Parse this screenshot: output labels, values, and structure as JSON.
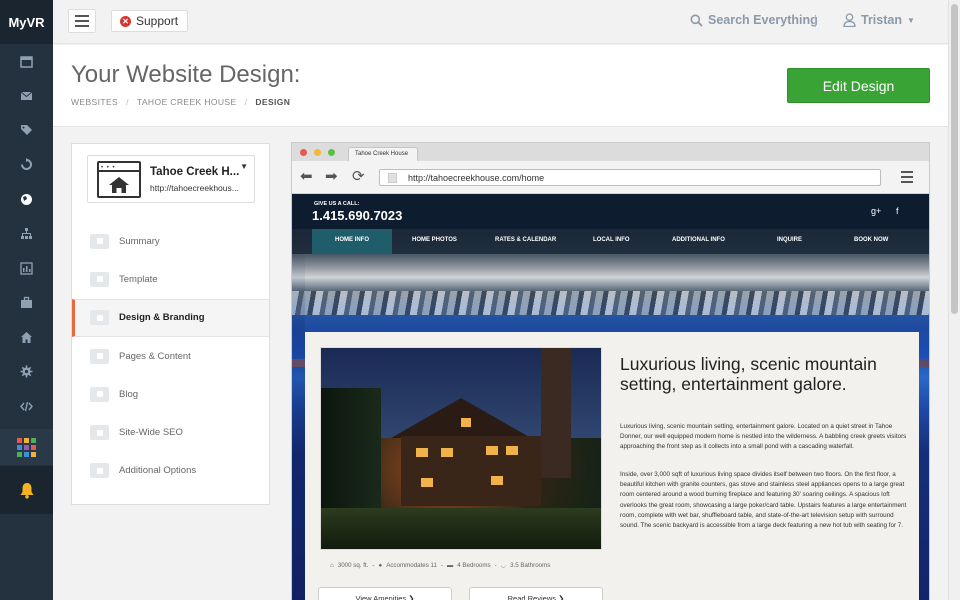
{
  "app": {
    "logo": "MyVR"
  },
  "rail": {
    "icons": [
      "calendar-icon",
      "mail-icon",
      "tag-icon",
      "sync-icon",
      "globe-icon",
      "sitemap-icon",
      "chart-icon",
      "briefcase-icon",
      "home-icon",
      "gear-icon",
      "code-icon"
    ],
    "apps_colors": [
      "#e7574a",
      "#f0b13a",
      "#4cb05a",
      "#3f8fd8",
      "#9b59b6",
      "#e7574a",
      "#4cb05a",
      "#3f8fd8",
      "#f0b13a"
    ],
    "bell_color": "#f5b321"
  },
  "topbar": {
    "support_label": "Support",
    "search_label": "Search Everything",
    "divider_char": "|",
    "user_name": "Tristan"
  },
  "header": {
    "title": "Your Website Design:",
    "breadcrumb": [
      "WEBSITES",
      "TAHOE CREEK HOUSE",
      "DESIGN"
    ],
    "breadcrumb_sep": "/",
    "edit_button": "Edit Design",
    "accent": "#3aa335"
  },
  "sidebar_card": {
    "site_name": "Tahoe Creek H...",
    "site_url": "http://tahoecreekhous...",
    "menu": [
      {
        "label": "Summary",
        "active": false
      },
      {
        "label": "Template",
        "active": false
      },
      {
        "label": "Design & Branding",
        "active": true
      },
      {
        "label": "Pages & Content",
        "active": false
      },
      {
        "label": "Blog",
        "active": false
      },
      {
        "label": "Site-Wide SEO",
        "active": false
      },
      {
        "label": "Additional Options",
        "active": false
      }
    ],
    "active_accent": "#e96a3c"
  },
  "browser": {
    "tab_title": "Tahoe Creek House",
    "url": "http://tahoecreekhouse.com/home",
    "dots": [
      "#f0544e",
      "#f5b82f",
      "#57c23f"
    ]
  },
  "site": {
    "call_label": "GIVE US A CALL:",
    "phone": "1.415.690.7023",
    "social": [
      "g+",
      "f"
    ],
    "nav": [
      "HOME INFO",
      "HOME PHOTOS",
      "RATES & CALENDAR",
      "LOCAL INFO",
      "ADDITIONAL INFO",
      "INQUIRE",
      "BOOK NOW"
    ],
    "headline": "Luxurious living, scenic mountain setting, entertainment galore.",
    "para1": "Luxurious living, scenic mountain setting, entertainment galore. Located on a quiet street in Tahoe Donner, our well equipped modern home is nestled into the wilderness. A babbling creek greets visitors approaching the front step as it collects into a small pond with a cascading waterfall.",
    "para2": "Inside, over 3,000 sqft of luxurious living space divides itself between two floors. On the first floor, a beautiful kitchen with granite counters, gas stove and stainless steel appliances opens to a large great room centered around a wood burning fireplace and featuring 30' soaring ceilings. A spacious loft overlooks the great room, showcasing a large poker/card table. Upstairs features a large entertainment room, complete with wet bar, shuffleboard table, and state-of-the-art television setup with surround sound. The scenic backyard is accessible from a large deck featuring a new hot tub with seating for 7.",
    "specs": [
      "3000 sq. ft.",
      "Accommodates 11",
      "4 Bedrooms",
      "3.5 Bathrooms"
    ],
    "spec_sep": "-",
    "buttons": [
      "View Amenities ❯",
      "Read Reviews ❯"
    ]
  }
}
